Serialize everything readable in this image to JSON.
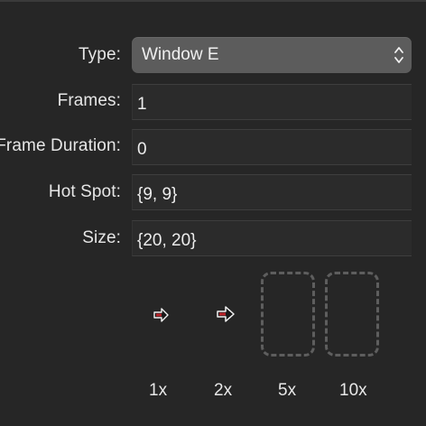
{
  "inspector": {
    "type": {
      "label": "Type:",
      "value": "Window E",
      "icon": "up-down-chevron-icon"
    },
    "frames": {
      "label": "Frames:",
      "value": "1"
    },
    "frame_duration": {
      "label": "Frame Duration:",
      "value": "0"
    },
    "hot_spot": {
      "label": "Hot Spot:",
      "value": "{9, 9}"
    },
    "size": {
      "label": "Size:",
      "value": "{20, 20}"
    }
  },
  "previews": {
    "scales": [
      "1x",
      "2x",
      "5x",
      "10x"
    ],
    "icon": "right-arrow-cursor-icon",
    "accent": "#c0272d"
  }
}
